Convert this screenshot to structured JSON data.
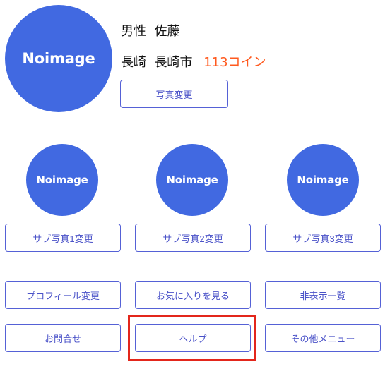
{
  "profile": {
    "avatar_text": "Noimage",
    "gender": "男性",
    "name": "佐藤",
    "prefecture": "長崎",
    "city": "長崎市",
    "coins": "113コイン",
    "change_photo_label": "写真変更"
  },
  "sub_photos": [
    {
      "avatar_text": "Noimage",
      "button_label": "サブ写真1変更"
    },
    {
      "avatar_text": "Noimage",
      "button_label": "サブ写真2変更"
    },
    {
      "avatar_text": "Noimage",
      "button_label": "サブ写真3変更"
    }
  ],
  "menu": {
    "profile_edit": "プロフィール変更",
    "favorites": "お気に入りを見る",
    "hidden_list": "非表示一覧",
    "contact": "お問合せ",
    "help": "ヘルプ",
    "other_menu": "その他メニュー"
  },
  "colors": {
    "avatar_bg": "#4169e1",
    "button_border": "#5561d6",
    "coin_text": "#ff5a1f",
    "highlight": "#e3261b"
  }
}
